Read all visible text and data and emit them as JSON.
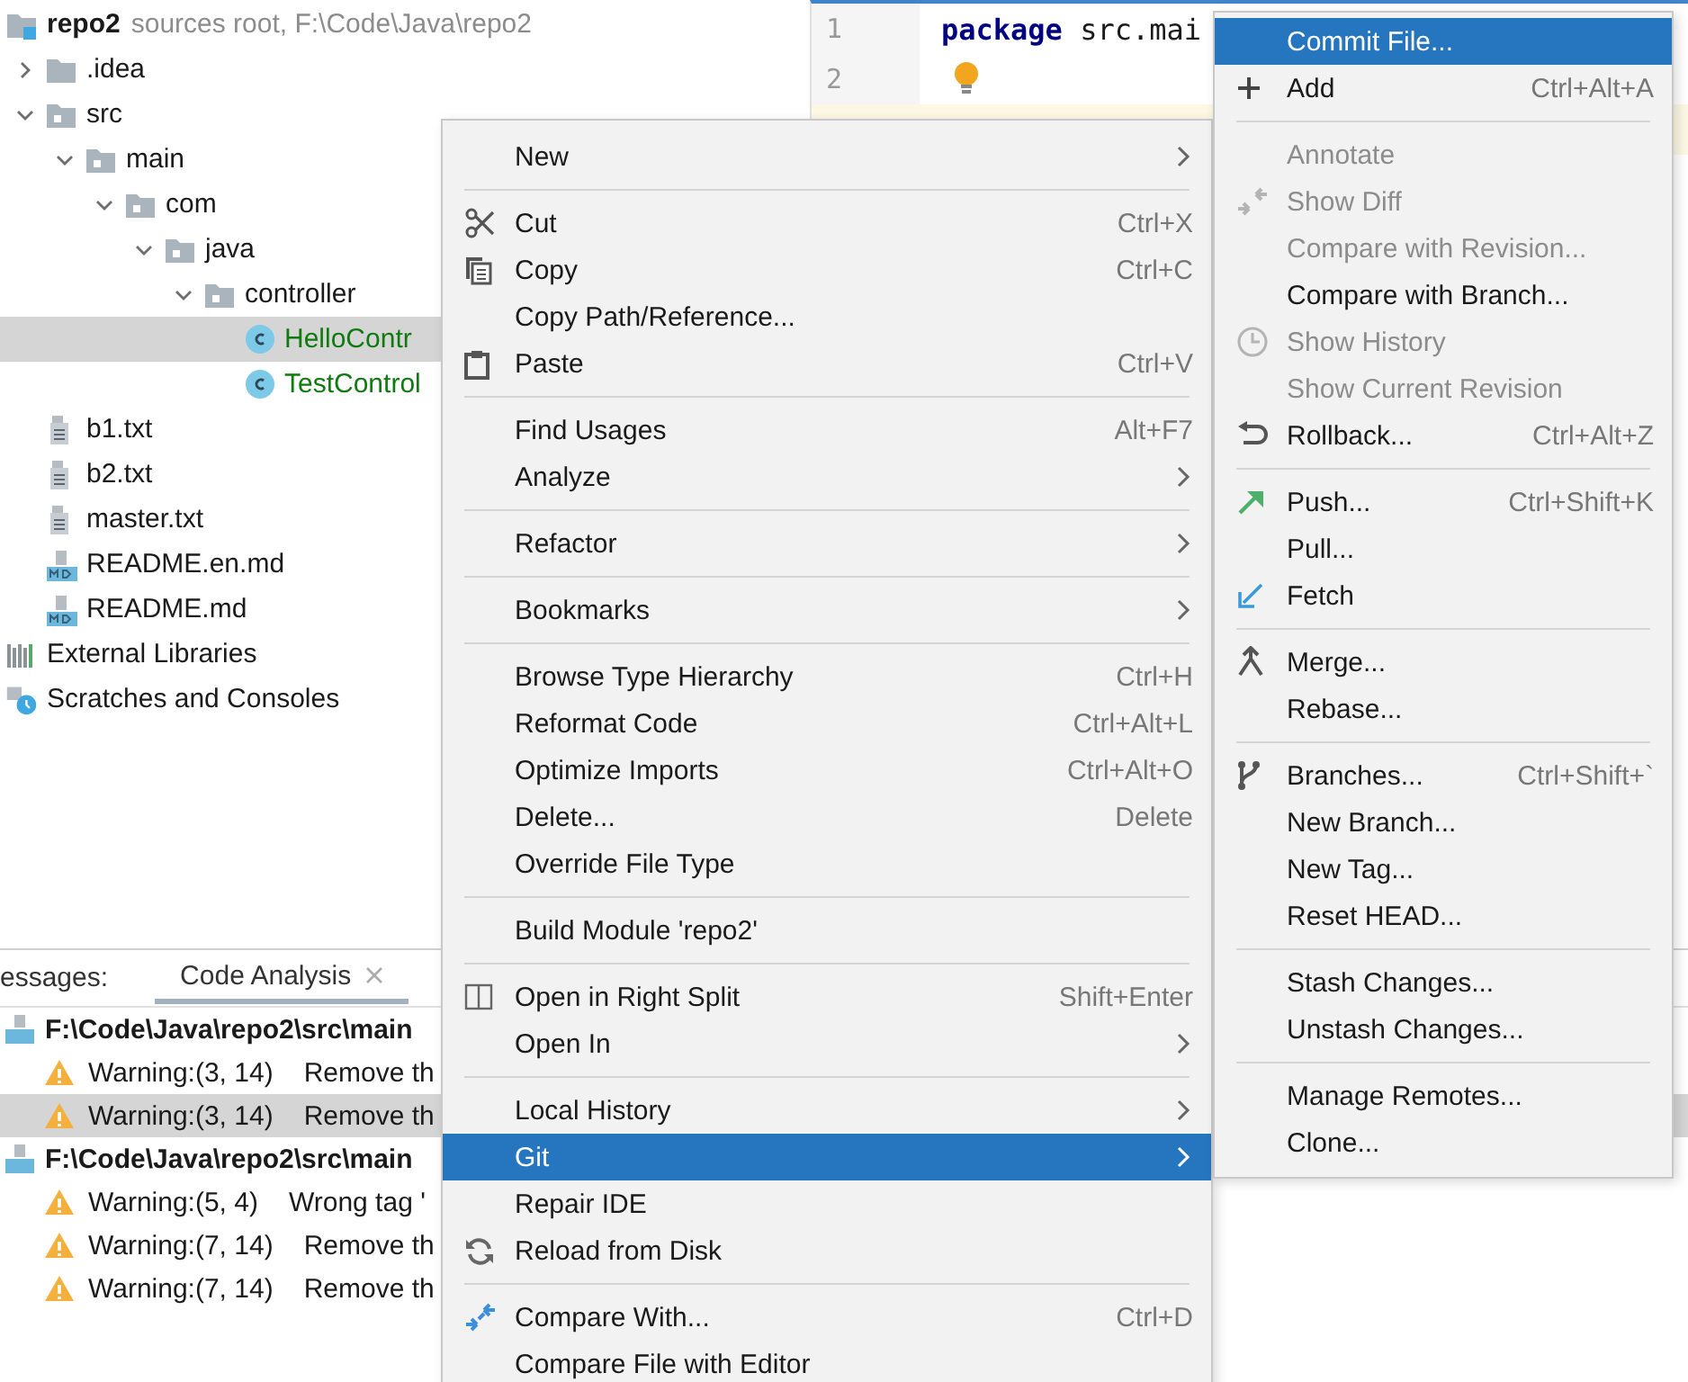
{
  "project_tree": {
    "items": [
      {
        "label": "repo2",
        "kind": "module",
        "hint": "sources root,  F:\\Code\\Java\\repo2",
        "selected": false,
        "children": [
          {
            "label": ".idea",
            "kind": "folder",
            "expanded": false,
            "selected": false
          },
          {
            "label": "src",
            "kind": "source",
            "expanded": true,
            "selected": false,
            "children": [
              {
                "label": "main",
                "kind": "source",
                "expanded": true,
                "selected": false,
                "children": [
                  {
                    "label": "com",
                    "kind": "source",
                    "expanded": true,
                    "selected": false,
                    "children": [
                      {
                        "label": "java",
                        "kind": "source",
                        "expanded": true,
                        "selected": false,
                        "children": [
                          {
                            "label": "controller",
                            "kind": "source",
                            "expanded": true,
                            "selected": false,
                            "children": [
                              {
                                "label": "HelloContr",
                                "kind": "class",
                                "selected": true
                              },
                              {
                                "label": "TestControl",
                                "kind": "class",
                                "selected": false
                              }
                            ]
                          }
                        ]
                      }
                    ]
                  }
                ]
              }
            ]
          },
          {
            "label": "b1.txt",
            "kind": "text",
            "selected": false
          },
          {
            "label": "b2.txt",
            "kind": "text",
            "selected": false
          },
          {
            "label": "master.txt",
            "kind": "text",
            "selected": false
          },
          {
            "label": "README.en.md",
            "kind": "markdown",
            "selected": false
          },
          {
            "label": "README.md",
            "kind": "markdown",
            "selected": false
          }
        ]
      },
      {
        "label": "External Libraries",
        "kind": "libraries",
        "selected": false
      },
      {
        "label": "Scratches and Consoles",
        "kind": "scratches",
        "selected": false
      }
    ]
  },
  "editor": {
    "lines": [
      {
        "number": "1",
        "code": "package src.mai",
        "current": false
      },
      {
        "number": "2",
        "bulb": true,
        "current": false
      },
      {
        "current": true
      }
    ]
  },
  "messages_panel": {
    "prefix": "essages:",
    "tabs": [
      {
        "label": "Code Analysis",
        "selected": true,
        "closable": true
      }
    ],
    "groups": [
      {
        "path": "F:\\Code\\Java\\repo2\\src\\main",
        "warnings": [
          {
            "location": "Warning:(3, 14)",
            "text": "Remove th",
            "selected": false
          },
          {
            "location": "Warning:(3, 14)",
            "text": "Remove th",
            "selected": true
          }
        ]
      },
      {
        "path": "F:\\Code\\Java\\repo2\\src\\main",
        "warnings": [
          {
            "location": "Warning:(5, 4)",
            "text": "Wrong tag '",
            "selected": false
          },
          {
            "location": "Warning:(7, 14)",
            "text": "Remove th",
            "selected": false
          },
          {
            "location": "Warning:(7, 14)",
            "text": "Remove th",
            "selected": false
          }
        ]
      }
    ]
  },
  "context_menu": {
    "items": [
      {
        "kind": "item",
        "label": "New",
        "submenu": true,
        "selected": false
      },
      {
        "kind": "separator"
      },
      {
        "kind": "item",
        "label": "Cut",
        "shortcut": "Ctrl+X",
        "selected": false
      },
      {
        "kind": "item",
        "label": "Copy",
        "shortcut": "Ctrl+C",
        "selected": false
      },
      {
        "kind": "item",
        "label": "Copy Path/Reference...",
        "selected": false
      },
      {
        "kind": "item",
        "label": "Paste",
        "shortcut": "Ctrl+V",
        "selected": false
      },
      {
        "kind": "separator"
      },
      {
        "kind": "item",
        "label": "Find Usages",
        "shortcut": "Alt+F7",
        "selected": false
      },
      {
        "kind": "item",
        "label": "Analyze",
        "submenu": true,
        "selected": false
      },
      {
        "kind": "separator"
      },
      {
        "kind": "item",
        "label": "Refactor",
        "submenu": true,
        "selected": false
      },
      {
        "kind": "separator"
      },
      {
        "kind": "item",
        "label": "Bookmarks",
        "submenu": true,
        "selected": false
      },
      {
        "kind": "separator"
      },
      {
        "kind": "item",
        "label": "Browse Type Hierarchy",
        "shortcut": "Ctrl+H",
        "selected": false
      },
      {
        "kind": "item",
        "label": "Reformat Code",
        "shortcut": "Ctrl+Alt+L",
        "selected": false
      },
      {
        "kind": "item",
        "label": "Optimize Imports",
        "shortcut": "Ctrl+Alt+O",
        "selected": false
      },
      {
        "kind": "item",
        "label": "Delete...",
        "shortcut": "Delete",
        "selected": false
      },
      {
        "kind": "item",
        "label": "Override File Type",
        "selected": false
      },
      {
        "kind": "separator"
      },
      {
        "kind": "item",
        "label": "Build Module 'repo2'",
        "selected": false
      },
      {
        "kind": "separator"
      },
      {
        "kind": "item",
        "label": "Open in Right Split",
        "shortcut": "Shift+Enter",
        "selected": false
      },
      {
        "kind": "item",
        "label": "Open In",
        "submenu": true,
        "selected": false
      },
      {
        "kind": "separator"
      },
      {
        "kind": "item",
        "label": "Local History",
        "submenu": true,
        "selected": false
      },
      {
        "kind": "item",
        "label": "Git",
        "submenu": true,
        "selected": true
      },
      {
        "kind": "item",
        "label": "Repair IDE",
        "selected": false
      },
      {
        "kind": "item",
        "label": "Reload from Disk",
        "selected": false
      },
      {
        "kind": "separator"
      },
      {
        "kind": "item",
        "label": "Compare With...",
        "shortcut": "Ctrl+D",
        "selected": false
      },
      {
        "kind": "item",
        "label": "Compare File with Editor",
        "selected": false
      }
    ]
  },
  "git_submenu": {
    "items": [
      {
        "kind": "item",
        "label": "Commit File...",
        "selected": true,
        "disabled": false
      },
      {
        "kind": "item",
        "label": "Add",
        "shortcut": "Ctrl+Alt+A",
        "selected": false,
        "disabled": false
      },
      {
        "kind": "separator"
      },
      {
        "kind": "item",
        "label": "Annotate",
        "selected": false,
        "disabled": true
      },
      {
        "kind": "item",
        "label": "Show Diff",
        "selected": false,
        "disabled": true
      },
      {
        "kind": "item",
        "label": "Compare with Revision...",
        "selected": false,
        "disabled": true
      },
      {
        "kind": "item",
        "label": "Compare with Branch...",
        "selected": false,
        "disabled": false
      },
      {
        "kind": "item",
        "label": "Show History",
        "selected": false,
        "disabled": true
      },
      {
        "kind": "item",
        "label": "Show Current Revision",
        "selected": false,
        "disabled": true
      },
      {
        "kind": "item",
        "label": "Rollback...",
        "shortcut": "Ctrl+Alt+Z",
        "selected": false,
        "disabled": false
      },
      {
        "kind": "separator"
      },
      {
        "kind": "item",
        "label": "Push...",
        "shortcut": "Ctrl+Shift+K",
        "selected": false,
        "disabled": false
      },
      {
        "kind": "item",
        "label": "Pull...",
        "selected": false,
        "disabled": false
      },
      {
        "kind": "item",
        "label": "Fetch",
        "selected": false,
        "disabled": false
      },
      {
        "kind": "separator"
      },
      {
        "kind": "item",
        "label": "Merge...",
        "selected": false,
        "disabled": false
      },
      {
        "kind": "item",
        "label": "Rebase...",
        "selected": false,
        "disabled": false
      },
      {
        "kind": "separator"
      },
      {
        "kind": "item",
        "label": "Branches...",
        "shortcut": "Ctrl+Shift+`",
        "selected": false,
        "disabled": false
      },
      {
        "kind": "item",
        "label": "New Branch...",
        "selected": false,
        "disabled": false
      },
      {
        "kind": "item",
        "label": "New Tag...",
        "selected": false,
        "disabled": false
      },
      {
        "kind": "item",
        "label": "Reset HEAD...",
        "selected": false,
        "disabled": false
      },
      {
        "kind": "separator"
      },
      {
        "kind": "item",
        "label": "Stash Changes...",
        "selected": false,
        "disabled": false
      },
      {
        "kind": "item",
        "label": "Unstash Changes...",
        "selected": false,
        "disabled": false
      },
      {
        "kind": "separator"
      },
      {
        "kind": "item",
        "label": "Manage Remotes...",
        "selected": false,
        "disabled": false
      },
      {
        "kind": "item",
        "label": "Clone...",
        "selected": false,
        "disabled": false
      }
    ]
  }
}
